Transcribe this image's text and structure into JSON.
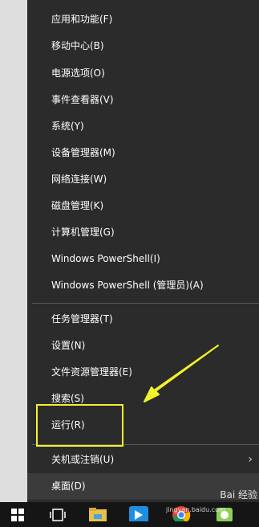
{
  "menu": {
    "items": [
      {
        "label": "应用和功能(F)"
      },
      {
        "label": "移动中心(B)"
      },
      {
        "label": "电源选项(O)"
      },
      {
        "label": "事件查看器(V)"
      },
      {
        "label": "系统(Y)"
      },
      {
        "label": "设备管理器(M)"
      },
      {
        "label": "网络连接(W)"
      },
      {
        "label": "磁盘管理(K)"
      },
      {
        "label": "计算机管理(G)"
      },
      {
        "label": "Windows PowerShell(I)"
      },
      {
        "label": "Windows PowerShell (管理员)(A)"
      },
      {
        "label": "任务管理器(T)"
      },
      {
        "label": "设置(N)"
      },
      {
        "label": "文件资源管理器(E)"
      },
      {
        "label": "搜索(S)"
      },
      {
        "label": "运行(R)"
      },
      {
        "label": "关机或注销(U)",
        "submenu_chevron": "›"
      },
      {
        "label": "桌面(D)"
      }
    ]
  },
  "annotation": {
    "color": "#f2f22a",
    "target": "运行(R)"
  },
  "watermark": {
    "brand": "Bai 经验",
    "url": "jingyan.baidu.com"
  },
  "taskbar": {
    "icons": [
      "windows-start-icon",
      "task-view-icon",
      "file-explorer-icon",
      "app-icon",
      "chrome-icon",
      "app-icon"
    ]
  }
}
